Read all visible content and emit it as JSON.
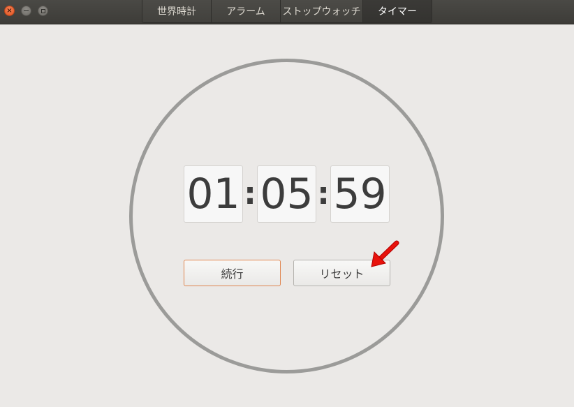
{
  "window": {
    "close_icon": "close-icon",
    "minimize_icon": "minimize-icon",
    "maximize_icon": "maximize-icon"
  },
  "tabs": [
    {
      "label": "世界時計",
      "active": false
    },
    {
      "label": "アラーム",
      "active": false
    },
    {
      "label": "ストップウォッチ",
      "active": false
    },
    {
      "label": "タイマー",
      "active": true
    }
  ],
  "timer": {
    "hours": "01",
    "minutes": "05",
    "seconds": "59",
    "separator": ":"
  },
  "buttons": {
    "resume_label": "続行",
    "reset_label": "リセット"
  },
  "annotation": {
    "arrow_color": "#e8120c"
  },
  "colors": {
    "accent": "#e0854f",
    "ring": "#9b9b99",
    "background": "#ebe9e7"
  }
}
